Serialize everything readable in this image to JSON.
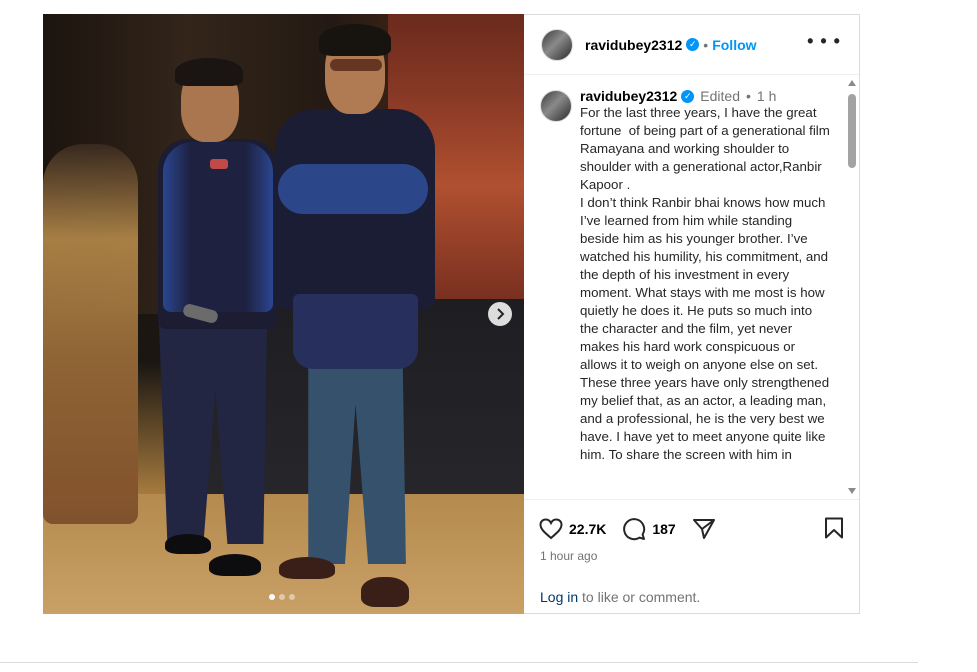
{
  "header": {
    "username": "ravidubey2312",
    "separator": "•",
    "follow_label": "Follow",
    "more_icon": "more-horizontal-icon"
  },
  "caption": {
    "username": "ravidubey2312",
    "edited": "Edited",
    "dot": "•",
    "time": "1 h",
    "text": "For the last three years, I have the great fortune  of being part of a generational film Ramayana and working shoulder to shoulder with a generational actor,Ranbir Kapoor .\nI don’t think Ranbir bhai knows how much I’ve learned from him while standing beside him as his younger brother. I’ve watched his humility, his commitment, and the depth of his investment in every moment. What stays with me most is how quietly he does it. He puts so much into the character and the film, yet never makes his hard work conspicuous or allows it to weigh on anyone else on set.\nThese three years have only strengthened my belief that, as an actor, a leading man, and a professional, he is the very best we have. I have yet to meet anyone quite like him. To share the screen with him in"
  },
  "actions": {
    "likes": "22.7K",
    "comments": "187",
    "icons": [
      "heart-icon",
      "comment-icon",
      "share-icon",
      "bookmark-icon"
    ]
  },
  "timestamp": "1 hour ago",
  "login_prompt": {
    "link": "Log in",
    "rest": " to like or comment."
  },
  "carousel": {
    "dots": 3,
    "active_dot": 1,
    "next_icon": "chevron-right-icon"
  },
  "colors": {
    "accent": "#0095f6",
    "link": "#00376b",
    "muted": "#737373"
  }
}
